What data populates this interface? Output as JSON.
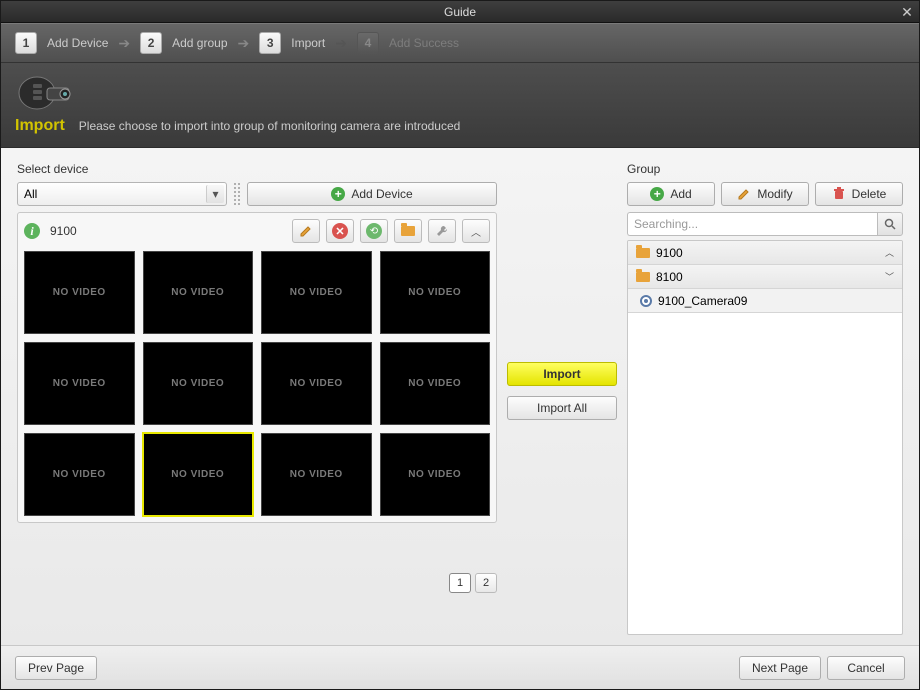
{
  "window": {
    "title": "Guide"
  },
  "steps": [
    {
      "num": "1",
      "label": "Add Device",
      "state": "done"
    },
    {
      "num": "2",
      "label": "Add group",
      "state": "done"
    },
    {
      "num": "3",
      "label": "Import",
      "state": "current"
    },
    {
      "num": "4",
      "label": "Add Success",
      "state": "upcoming"
    }
  ],
  "header": {
    "title": "Import",
    "description": "Please choose to import into group of monitoring camera are introduced"
  },
  "left": {
    "section_label": "Select device",
    "device_filter": "All",
    "add_device_label": "Add Device",
    "device_name": "9100",
    "thumbs": [
      {
        "text": "NO VIDEO"
      },
      {
        "text": "NO VIDEO"
      },
      {
        "text": "NO VIDEO"
      },
      {
        "text": "NO VIDEO"
      },
      {
        "text": "NO VIDEO"
      },
      {
        "text": "NO VIDEO"
      },
      {
        "text": "NO VIDEO"
      },
      {
        "text": "NO VIDEO"
      },
      {
        "text": "NO VIDEO"
      },
      {
        "text": "NO VIDEO",
        "selected": true
      },
      {
        "text": "NO VIDEO"
      },
      {
        "text": "NO VIDEO"
      }
    ],
    "pages": [
      "1",
      "2"
    ],
    "current_page": "1"
  },
  "center": {
    "import_label": "Import",
    "import_all_label": "Import All"
  },
  "right": {
    "section_label": "Group",
    "buttons": {
      "add": "Add",
      "modify": "Modify",
      "delete": "Delete"
    },
    "search_placeholder": "Searching...",
    "groups": [
      {
        "name": "9100",
        "collapsed": true
      },
      {
        "name": "8100",
        "expanded": true,
        "children": [
          {
            "name": "9100_Camera09"
          }
        ]
      }
    ]
  },
  "footer": {
    "prev": "Prev Page",
    "next": "Next Page",
    "cancel": "Cancel"
  }
}
